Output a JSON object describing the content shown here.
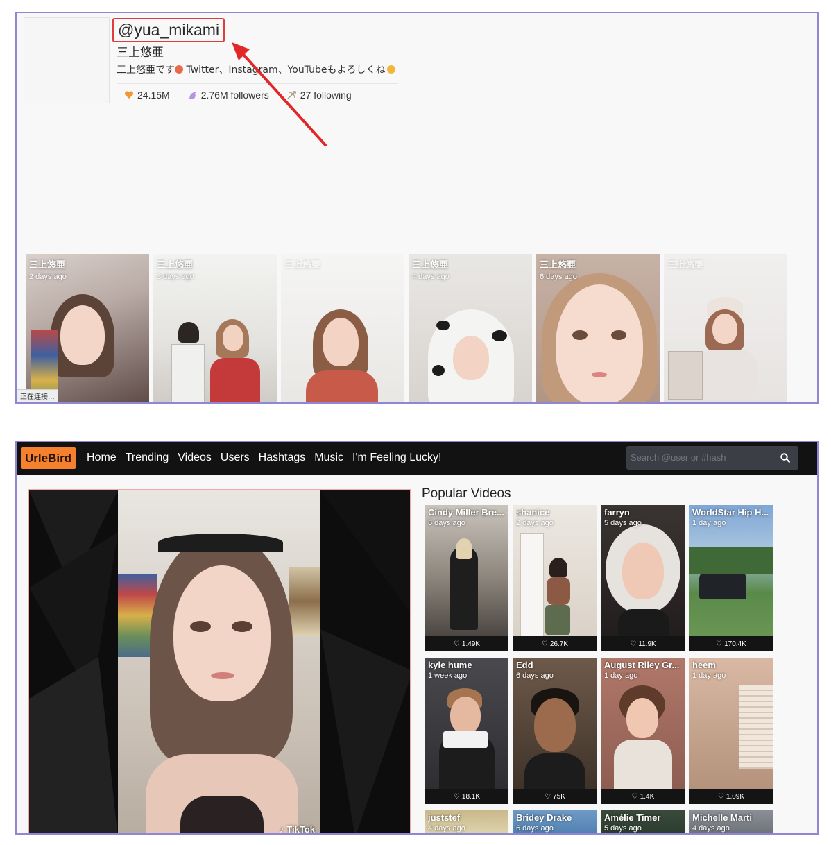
{
  "profile": {
    "username": "@yua_mikami",
    "display_name": "三上悠亜",
    "bio_part1": "三上悠亜です",
    "bio_part2": " Twitter、Instagram、YouTubeもよろしくね",
    "likes": "24.15M",
    "followers": "2.76M followers",
    "following": "27 following",
    "status_bar": "正在连接..."
  },
  "profile_videos": [
    {
      "name": "三上悠亜",
      "time": "2 days ago"
    },
    {
      "name": "三上悠亜",
      "time": "3 days ago"
    },
    {
      "name": "三上悠亜",
      "time": ""
    },
    {
      "name": "三上悠亜",
      "time": "4 days ago"
    },
    {
      "name": "三上悠亜",
      "time": "6 days ago"
    },
    {
      "name": "三上悠亜",
      "time": ""
    }
  ],
  "nav": {
    "logo": "UrleBird",
    "links": [
      "Home",
      "Trending",
      "Videos",
      "Users",
      "Hashtags",
      "Music",
      "I'm Feeling Lucky!"
    ],
    "search_placeholder": "Search @user or #hash"
  },
  "player": {
    "watermark": "TikTok"
  },
  "popular": {
    "title": "Popular Videos",
    "cards": [
      {
        "name": "Cindy Miller Bre...",
        "time": "6 days ago",
        "likes": "1.49K"
      },
      {
        "name": "shanice",
        "time": "2 days ago",
        "likes": "26.7K"
      },
      {
        "name": "farryn",
        "time": "5 days ago",
        "likes": "11.9K"
      },
      {
        "name": "WorldStar Hip H...",
        "time": "1 day ago",
        "likes": "170.4K"
      },
      {
        "name": "kyle hume",
        "time": "1 week ago",
        "likes": "18.1K"
      },
      {
        "name": "Edd",
        "time": "6 days ago",
        "likes": "75K"
      },
      {
        "name": "August Riley Gr...",
        "time": "1 day ago",
        "likes": "1.4K"
      },
      {
        "name": "heem",
        "time": "1 day ago",
        "likes": "1.09K"
      },
      {
        "name": "juststef",
        "time": "4 days ago",
        "likes": ""
      },
      {
        "name": "Bridey Drake",
        "time": "6 days ago",
        "likes": ""
      },
      {
        "name": "Amélie Timer",
        "time": "5 days ago",
        "likes": ""
      },
      {
        "name": "Michelle Marti",
        "time": "4 days ago",
        "likes": ""
      }
    ]
  },
  "colors": {
    "accent": "#f5812e",
    "annotation_red": "#e23b3b",
    "frame": "#8f86d6",
    "nav_bg": "#121212"
  }
}
